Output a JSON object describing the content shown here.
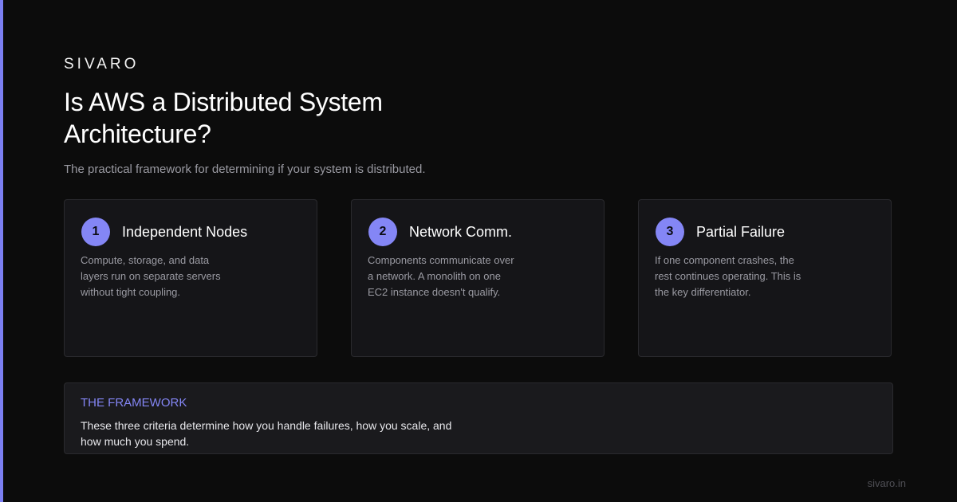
{
  "brand": "SIVARO",
  "title": "Is AWS a Distributed System Architecture?",
  "subtitle": "The practical framework for determining if your system is distributed.",
  "accent_color": "#7c7ff2",
  "cards": [
    {
      "number": "1",
      "title": "Independent Nodes",
      "body": "Compute, storage, and data layers run on separate servers without tight coupling."
    },
    {
      "number": "2",
      "title": "Network Comm.",
      "body": "Components communicate over a network. A monolith on one EC2 instance doesn't qualify."
    },
    {
      "number": "3",
      "title": "Partial Failure",
      "body": "If one component crashes, the rest continues operating. This is the key differentiator."
    }
  ],
  "framework": {
    "label": "THE FRAMEWORK",
    "text": "These three criteria determine how you handle failures, how you scale, and how much you spend."
  },
  "footer": "sivaro.in"
}
